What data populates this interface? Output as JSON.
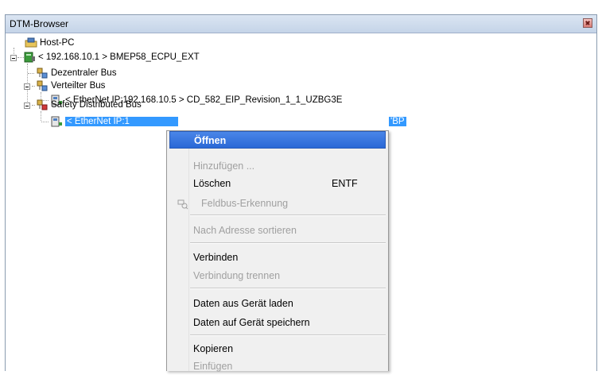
{
  "window": {
    "title": "DTM-Browser"
  },
  "tree": {
    "root": "Host-PC",
    "cpu": "< 192.168.10.1 > BMEP58_ECPU_EXT",
    "bus1": "Dezentraler Bus",
    "bus2": "Verteilter Bus",
    "device1": "< EtherNet IP:192.168.10.5 > CD_582_EIP_Revision_1_1_UZBG3E",
    "bus3": "Safety Distributed Bus",
    "device2_left": "< EtherNet IP:1",
    "device2_right": "'BP"
  },
  "context_menu": {
    "items": [
      {
        "label": "Öffnen"
      },
      {
        "label": "Hinzufügen ..."
      },
      {
        "label": "Löschen",
        "shortcut": "ENTF"
      },
      {
        "label": "Feldbus-Erkennung"
      },
      {
        "label": "Nach Adresse sortieren"
      },
      {
        "label": "Verbinden"
      },
      {
        "label": "Verbindung trennen"
      },
      {
        "label": "Daten aus Gerät laden"
      },
      {
        "label": "Daten auf Gerät speichern"
      },
      {
        "label": "Kopieren"
      },
      {
        "label": "Einfügen"
      }
    ]
  }
}
